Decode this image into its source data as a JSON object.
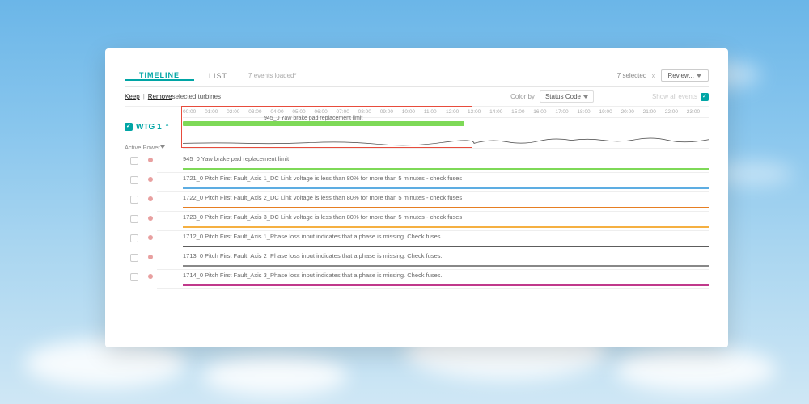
{
  "tabs": {
    "timeline": "TIMELINE",
    "list": "LIST",
    "loaded": "7 events loaded*"
  },
  "header": {
    "selected_count": "7 selected",
    "review_label": "Review..."
  },
  "subbar": {
    "keep": "Keep",
    "remove": "Remove",
    "suffix": " selected turbines",
    "colorby_label": "Color by",
    "colorby_value": "Status Code",
    "show_all": "Show all events"
  },
  "turbine": "WTG 1",
  "metric": "Active Power",
  "time_ticks": [
    "00:00",
    "01:00",
    "02:00",
    "03:00",
    "04:00",
    "05:00",
    "06:00",
    "07:00",
    "08:00",
    "09:00",
    "10:00",
    "11:00",
    "12:00",
    "13:00",
    "14:00",
    "15:00",
    "16:00",
    "17:00",
    "18:00",
    "19:00",
    "20:00",
    "21:00",
    "22:00",
    "23:00"
  ],
  "overview_label": "945_0 Yaw brake pad replacement limit",
  "events": [
    {
      "text": "945_0 Yaw brake pad replacement limit",
      "color": "#7ed957"
    },
    {
      "text": "1721_0 Pitch First Fault_Axis 1_DC Link voltage is less than 80% for more than 5 minutes - check fuses",
      "color": "#5dade2"
    },
    {
      "text": "1722_0 Pitch First Fault_Axis 2_DC Link voltage is less than 80% for more than 5 minutes - check fuses",
      "color": "#e67e22"
    },
    {
      "text": "1723_0 Pitch First Fault_Axis 3_DC Link voltage is less than 80% for more than 5 minutes - check fuses",
      "color": "#f5b041"
    },
    {
      "text": "1712_0 Pitch First Fault_Axis 1_Phase loss input indicates that a phase is missing. Check fuses.",
      "color": "#5d5d5d"
    },
    {
      "text": "1713_0 Pitch First Fault_Axis 2_Phase loss input indicates that a phase is missing. Check fuses.",
      "color": "#888888"
    },
    {
      "text": "1714_0 Pitch First Fault_Axis 3_Phase loss input indicates that a phase is missing. Check fuses.",
      "color": "#c0398b"
    }
  ]
}
